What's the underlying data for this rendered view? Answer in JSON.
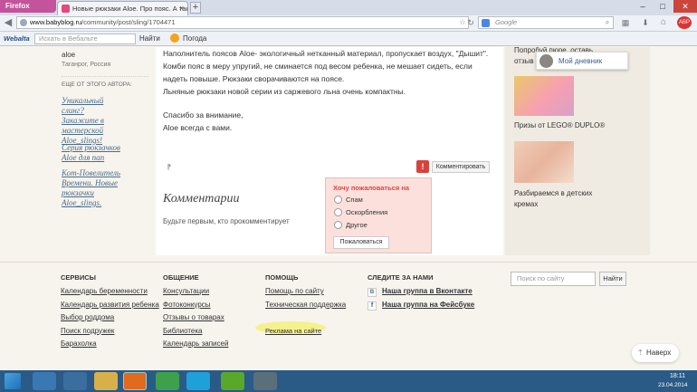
{
  "browser": {
    "app_button": "Firefox",
    "tab_title": "Новые рюкзаки Aloe. Про пояс. А так ...",
    "new_tab": "+",
    "url_domain": "www.babyblog.ru",
    "url_path": "/community/post/sling/1704471",
    "search_placeholder": "Google"
  },
  "toolbar": {
    "brand": "Webalta",
    "search_placeholder": "Искать в Вебальте",
    "search_button": "Найти",
    "weather_label": "Погода"
  },
  "left": {
    "author_name": "aloe",
    "author_city": "Таганрог, Россия",
    "more_heading": "ЕЩЕ ОТ ЭТОГО АВТОРА:",
    "posts": [
      "Уникальный слинг? Закажите в мастерской Aloe_slings!",
      "Серия рюкзачков Aloe для пап",
      "Кот-Повелитель Времени. Новые рюкзачки Aloe_slings."
    ]
  },
  "post": {
    "lines": [
      "Наполнитель  поясов Aloe- экологичный нетканный материал, пропускает воздух, \"Дышит\".",
      "Комби пояс в меру упругий, не сминается под весом ребенка, не мешает сидеть, если",
      "надеть повыше.  Рюкзаки сворачиваются на поясе.",
      "Льняные рюкзаки новой серии из саржевого льна очень компактны."
    ],
    "thanks": "Спасибо за внимание,",
    "signature": "Aloe всегда с вами.",
    "comment_button": "Комментировать",
    "comments_title": "Комментарии",
    "no_comments": "Будьте первым, кто прокомментирует"
  },
  "complaint": {
    "title": "Хочу пожаловаться на",
    "options": [
      "Спам",
      "Оскорбления",
      "Другое"
    ],
    "button": "Пожаловаться"
  },
  "right": {
    "promo_top": "Попробуй пюре, оставь отзыв",
    "diary_label": "Мой дневник",
    "promo_lego": "Призы от LEGO® DUPLO®",
    "promo_cream": "Разбираемся в детских кремах"
  },
  "footer": {
    "services_heading": "СЕРВИСЫ",
    "services": [
      "Календарь беременности",
      "Календарь развития ребенка",
      "Выбор роддома",
      "Поиск подружек",
      "Барахолка"
    ],
    "communication_heading": "ОБЩЕНИЕ",
    "communication": [
      "Консультации",
      "Фотоконкурсы",
      "Отзывы о товарах",
      "Библиотека",
      "Календарь записей"
    ],
    "help_heading": "ПОМОЩЬ",
    "help": [
      "Помощь по сайту",
      "Техническая поддержка",
      "Реклама на сайте"
    ],
    "follow_heading": "СЛЕДИТЕ ЗА НАМИ",
    "follow": [
      "Наша группа в Вконтакте",
      "Наша группа на Фейсбуке"
    ],
    "search_placeholder": "Поиск по сайту",
    "search_button": "Найти",
    "back_to_top": "Наверх"
  },
  "taskbar": {
    "clock_time": "18:11",
    "clock_date": "23.04.2014"
  },
  "colors": {
    "accent_pink": "#e8467c",
    "link": "#4a6c8a",
    "complaint_bg": "#fbe0dc",
    "highlight": "#f5f07a"
  }
}
